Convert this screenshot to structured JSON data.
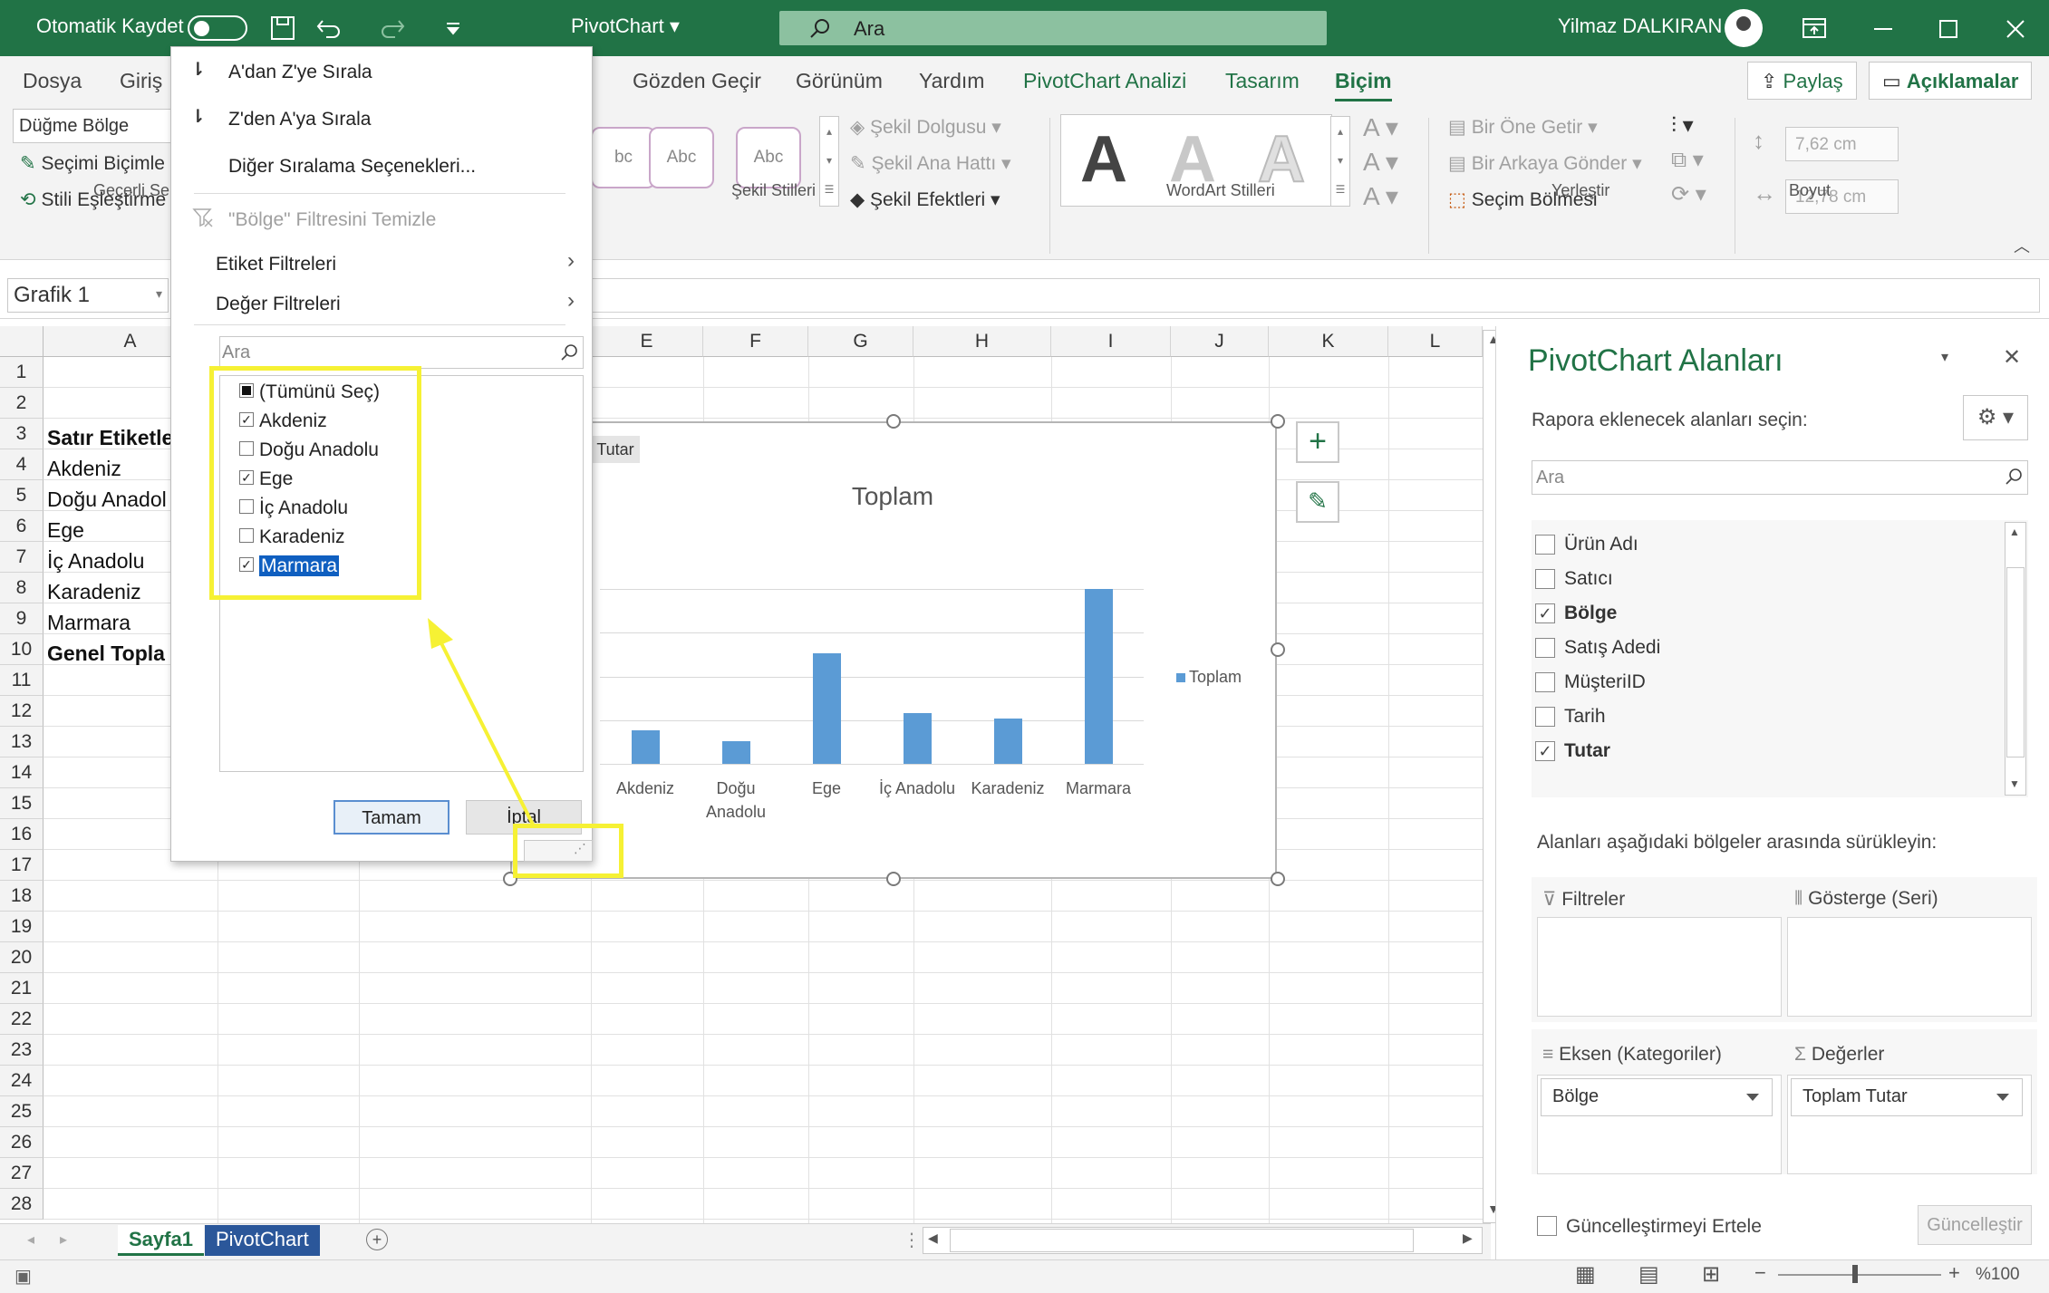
{
  "titlebar": {
    "autosave_label": "Otomatik Kaydet",
    "doc_title": "PivotChart",
    "search_placeholder": "Ara",
    "user_name": "Yilmaz DALKIRAN"
  },
  "ribbon": {
    "tabs": [
      "Dosya",
      "Giriş",
      "Gözden Geçir",
      "Görünüm",
      "Yardım",
      "PivotChart Analizi",
      "Tasarım",
      "Biçim"
    ],
    "share_label": "Paylaş",
    "comments_label": "Açıklamalar",
    "current_selection_value": "Düğme Bölge",
    "format_selection_label": "Seçimi Biçimle",
    "reset_style_label": "Stili Eşleştirme",
    "group_current_selection": "Geçerli Se",
    "style_sample": "Abc",
    "style_sample_partial": "bc",
    "shape_fill_label": "Şekil Dolgusu",
    "shape_outline_label": "Şekil Ana Hattı",
    "shape_effects_label": "Şekil Efektleri",
    "group_shape_styles": "Şekil Stilleri",
    "wordart_letter": "A",
    "group_wordart": "WordArt Stilleri",
    "bring_forward_label": "Bir Öne Getir",
    "send_backward_label": "Bir Arkaya Gönder",
    "selection_pane_label": "Seçim Bölmesi",
    "group_arrange": "Yerleştir",
    "height_value": "7,62 cm",
    "width_value": "12,78 cm",
    "group_size": "Boyut"
  },
  "formula": {
    "name_box": "Grafik 1"
  },
  "grid": {
    "columns": [
      "A",
      "E",
      "F",
      "G",
      "H",
      "I",
      "J",
      "K",
      "L"
    ],
    "rows": [
      "1",
      "2",
      "3",
      "4",
      "5",
      "6",
      "7",
      "8",
      "9",
      "10",
      "11",
      "12",
      "13",
      "14",
      "15",
      "16",
      "17",
      "18",
      "19",
      "20",
      "21",
      "22",
      "23",
      "24",
      "25",
      "26",
      "27",
      "28"
    ],
    "cells": [
      "",
      "",
      "Satır Etiketle",
      "Akdeniz",
      "Doğu Anadol",
      "Ege",
      "İç Anadolu",
      "Karadeniz",
      "Marmara",
      "Genel Topla"
    ]
  },
  "chart_data": {
    "type": "bar",
    "title": "Toplam",
    "field_button": "Tutar",
    "categories": [
      "Akdeniz",
      "Doğu Anadolu",
      "Ege",
      "İç Anadolu",
      "Karadeniz",
      "Marmara"
    ],
    "series": [
      {
        "name": "Toplam",
        "values": [
          19,
          13,
          63,
          29,
          26,
          100
        ]
      }
    ],
    "legend_position": "right",
    "grid": true,
    "color": "#5b9bd5"
  },
  "menu": {
    "sort_az": "A'dan Z'ye Sırala",
    "sort_za": "Z'den A'ya Sırala",
    "more_sort": "Diğer Sıralama Seçenekleri...",
    "clear_filter": "\"Bölge\" Filtresini Temizle",
    "label_filters": "Etiket Filtreleri",
    "value_filters": "Değer Filtreleri",
    "search_placeholder": "Ara",
    "items": [
      {
        "label": "(Tümünü Seç)",
        "state": "partial"
      },
      {
        "label": "Akdeniz",
        "state": "checked"
      },
      {
        "label": "Doğu Anadolu",
        "state": "unchecked"
      },
      {
        "label": "Ege",
        "state": "checked"
      },
      {
        "label": "İç Anadolu",
        "state": "unchecked"
      },
      {
        "label": "Karadeniz",
        "state": "unchecked"
      },
      {
        "label": "Marmara",
        "state": "checked"
      }
    ],
    "ok_label": "Tamam",
    "cancel_label": "İptal"
  },
  "pane": {
    "title": "PivotChart Alanları",
    "subtitle": "Rapora eklenecek alanları seçin:",
    "search_placeholder": "Ara",
    "fields": [
      {
        "label": "Ürün Adı",
        "checked": false
      },
      {
        "label": "Satıcı",
        "checked": false
      },
      {
        "label": "Bölge",
        "checked": true
      },
      {
        "label": "Satış Adedi",
        "checked": false
      },
      {
        "label": "MüşteriID",
        "checked": false
      },
      {
        "label": "Tarih",
        "checked": false
      },
      {
        "label": "Tutar",
        "checked": true
      }
    ],
    "drag_hint": "Alanları aşağıdaki bölgeler arasında sürükleyin:",
    "filters_label": "Filtreler",
    "legend_label": "Gösterge (Seri)",
    "axis_label": "Eksen (Kategoriler)",
    "values_label": "Değerler",
    "axis_value": "Bölge",
    "values_value": "Toplam Tutar",
    "defer_label": "Güncelleştirmeyi Ertele",
    "update_label": "Güncelleştir"
  },
  "sheets": {
    "tabs": [
      "Sayfa1",
      "PivotChart"
    ],
    "active": "PivotChart"
  },
  "status": {
    "zoom": "%100"
  }
}
